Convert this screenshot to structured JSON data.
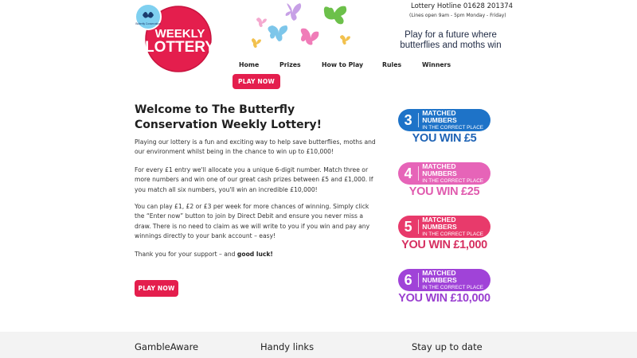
{
  "header": {
    "logo": {
      "badge_text": "Butterfly Conservation",
      "line1": "WEEKLY",
      "line2": "LOTTERY"
    },
    "hotline": "Lottery Hotline 01628 201374",
    "hours": "(Lines open 9am - 5pm Monday - Friday)",
    "tagline_line1": "Play for a future where",
    "tagline_line2": "butterflies and moths win"
  },
  "nav": {
    "items": [
      {
        "label": "Home"
      },
      {
        "label": "Prizes"
      },
      {
        "label": "How to Play"
      },
      {
        "label": "Rules"
      },
      {
        "label": "Winners"
      }
    ],
    "cta": "PLAY NOW"
  },
  "main": {
    "title": "Welcome to The Butterfly Conservation Weekly Lottery!",
    "paragraph1": "Playing our lottery is a fun and exciting way to help save butterflies, moths and our environment whilst being in the chance to win up to £10,000!",
    "paragraph2": "For every £1 entry we'll allocate you a unique 6-digit number. Match three or more numbers and win one of our great cash prizes between £5 and £1,000. If you match all six numbers, you'll win an incredible £10,000!",
    "paragraph3": "You can play £1, £2 or £3 per week for more chances of winning. Simply click the “Enter now” button to join by Direct Debit and ensure you never miss a draw. There is no need to claim as we will write to you if you win and pay any winnings directly to your bank account – easy!",
    "paragraph4_start": "Thank you for your support – and ",
    "paragraph4_bold": "good luck!",
    "cta": "PLAY NOW"
  },
  "prizes": [
    {
      "number": "3",
      "line1": "MATCHED NUMBERS",
      "line2": "IN THE CORRECT PLACE",
      "win": "YOU WIN £5",
      "color": "#1e73c8",
      "win_color": "#1e63b5"
    },
    {
      "number": "4",
      "line1": "MATCHED NUMBERS",
      "line2": "IN THE CORRECT PLACE",
      "win": "YOU WIN £25",
      "color": "#e664b8",
      "win_color": "#e05aae"
    },
    {
      "number": "5",
      "line1": "MATCHED NUMBERS",
      "line2": "IN THE CORRECT PLACE",
      "win": "YOU WIN £1,000",
      "color": "#e83a6b",
      "win_color": "#d62f60"
    },
    {
      "number": "6",
      "line1": "MATCHED NUMBERS",
      "line2": "IN THE CORRECT PLACE",
      "win": "YOU WIN £10,000",
      "color": "#a043d8",
      "win_color": "#9a3fd0"
    }
  ],
  "footer": {
    "col1": "GambleAware",
    "col2": "Handy links",
    "col3": "Stay up to date"
  }
}
